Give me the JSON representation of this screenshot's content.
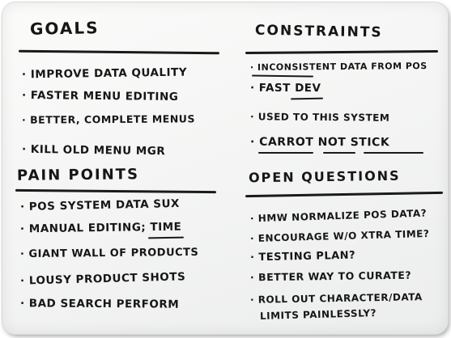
{
  "goals": {
    "title": "GOALS",
    "items": [
      "· IMPROVE DATA QUALITY",
      "· FASTER MENU EDITING",
      "· BETTER, COMPLETE MENUS",
      "· KILL OLD MENU MGR"
    ]
  },
  "pain_points": {
    "title": "PAIN POINTS",
    "items": [
      "· POS SYSTEM DATA SUX",
      "· MANUAL EDITING; TIME",
      "· GIANT WALL OF PRODUCTS",
      "· LOUSY PRODUCT SHOTS",
      "· BAD SEARCH PERFORM"
    ]
  },
  "constraints": {
    "title": "CONSTRAINTS",
    "items": [
      "· INCONSISTENT DATA FROM POS",
      "· FAST DEV",
      "· USED TO THIS SYSTEM",
      "· CARROT NOT STICK"
    ]
  },
  "open_questions": {
    "title": "OPEN QUESTIONS",
    "items": [
      "· HMW NORMALIZE POS DATA?",
      "· ENCOURAGE W/O XTRA TIME?",
      "· TESTING PLAN?",
      "· BETTER WAY TO CURATE?",
      "· ROLL OUT CHARACTER/DATA",
      "LIMITS PAINLESSLY?"
    ]
  }
}
